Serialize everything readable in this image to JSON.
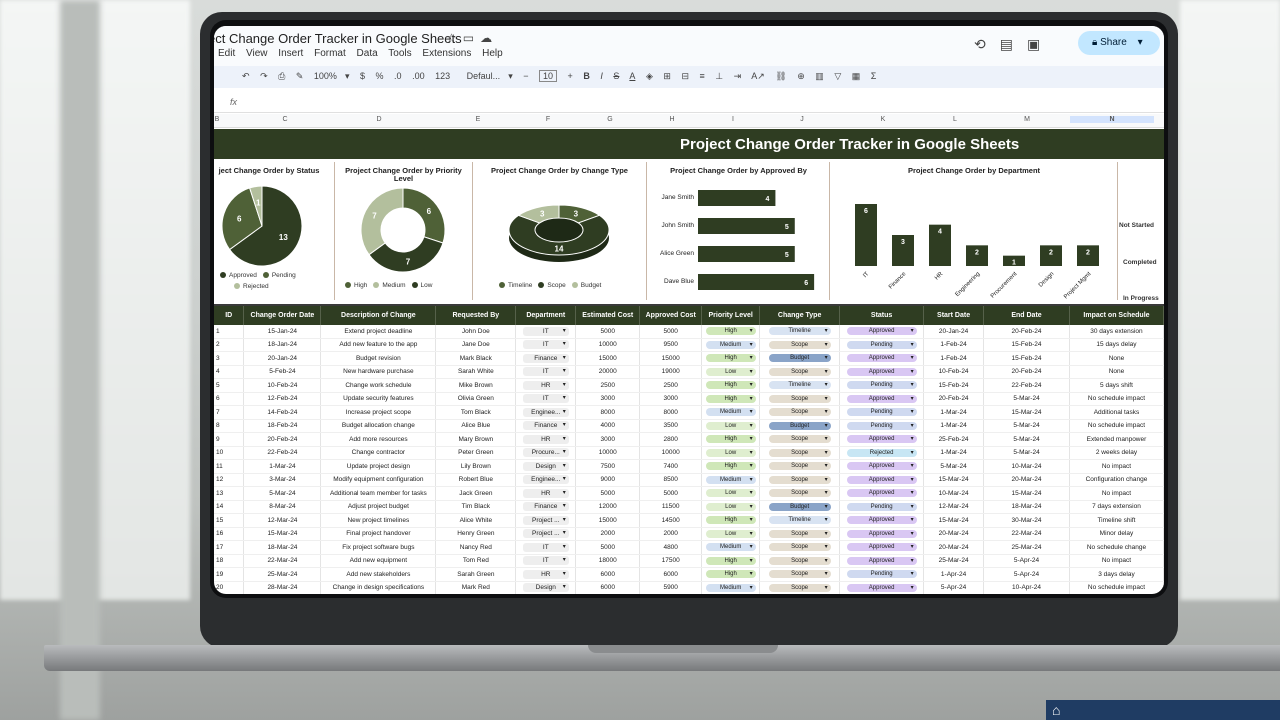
{
  "doc_title": "ect Change Order Tracker in Google Sheets",
  "menu": [
    "Edit",
    "View",
    "Insert",
    "Format",
    "Data",
    "Tools",
    "Extensions",
    "Help"
  ],
  "share_label": "Share",
  "toolbar": {
    "zoom": "100%",
    "font": "Defaul...",
    "font_size": "10",
    "format_num": "123",
    "currency": "$",
    "percent": "%"
  },
  "formula_icon": "fx",
  "columns": [
    "B",
    "C",
    "D",
    "E",
    "F",
    "G",
    "H",
    "I",
    "J",
    "K",
    "L",
    "M",
    "N"
  ],
  "banner": "Project Change Order Tracker in Google Sheets",
  "charts": {
    "status": {
      "title": "ject Change Order by Status",
      "legend": [
        "Approved",
        "Pending",
        "Rejected"
      ],
      "values": [
        13,
        6,
        1
      ]
    },
    "priority": {
      "title": "Project Change Order by Priority Level",
      "legend": [
        "High",
        "Medium",
        "Low"
      ],
      "values": [
        6,
        7,
        7
      ]
    },
    "type": {
      "title": "Project Change Order by Change Type",
      "legend": [
        "Timeline",
        "Scope",
        "Budget"
      ],
      "values": [
        3,
        14,
        3
      ]
    },
    "approved": {
      "title": "Project Change Order by Approved By",
      "names": [
        "Jane Smith",
        "John Smith",
        "Alice Green",
        "Dave Blue"
      ],
      "values": [
        4,
        5,
        5,
        6
      ]
    },
    "department": {
      "title": "Project Change Order by Department",
      "names": [
        "IT",
        "Finance",
        "HR",
        "Engineering",
        "Procurement",
        "Design",
        "Project Mgmt"
      ],
      "values": [
        6,
        3,
        4,
        2,
        1,
        2,
        2
      ]
    },
    "progress": {
      "labels": [
        "Not Started",
        "Completed",
        "In Progress"
      ]
    }
  },
  "colors": {
    "dark": "#2f3d22",
    "mid": "#4f6137",
    "light": "#b3bf9d",
    "approved": "#d9c7f3",
    "pending": "#cfd9f0",
    "rejected": "#c7e6f4",
    "high": "#cfe7b8",
    "medium": "#d3e0f1",
    "low": "#dfeecf",
    "timeline": "#d8e3f2",
    "scope": "#e4ddd0",
    "budget": "#8aa4c8"
  },
  "table_headers": [
    "ID",
    "Change Order Date",
    "Description of Change",
    "Requested By",
    "Department",
    "Estimated Cost",
    "Approved Cost",
    "Priority Level",
    "Change Type",
    "Status",
    "Start Date",
    "End Date",
    "Impact on Schedule"
  ],
  "rows": [
    [
      "1",
      "15-Jan-24",
      "Extend project deadline",
      "John Doe",
      "IT",
      "5000",
      "5000",
      "High",
      "Timeline",
      "Approved",
      "20-Jan-24",
      "20-Feb-24",
      "30 days extension"
    ],
    [
      "2",
      "18-Jan-24",
      "Add new feature to the app",
      "Jane Doe",
      "IT",
      "10000",
      "9500",
      "Medium",
      "Scope",
      "Pending",
      "1-Feb-24",
      "15-Feb-24",
      "15 days delay"
    ],
    [
      "3",
      "20-Jan-24",
      "Budget revision",
      "Mark Black",
      "Finance",
      "15000",
      "15000",
      "High",
      "Budget",
      "Approved",
      "1-Feb-24",
      "15-Feb-24",
      "None"
    ],
    [
      "4",
      "5-Feb-24",
      "New hardware purchase",
      "Sarah White",
      "IT",
      "20000",
      "19000",
      "Low",
      "Scope",
      "Approved",
      "10-Feb-24",
      "20-Feb-24",
      "None"
    ],
    [
      "5",
      "10-Feb-24",
      "Change work schedule",
      "Mike Brown",
      "HR",
      "2500",
      "2500",
      "High",
      "Timeline",
      "Pending",
      "15-Feb-24",
      "22-Feb-24",
      "5 days shift"
    ],
    [
      "6",
      "12-Feb-24",
      "Update security features",
      "Olivia Green",
      "IT",
      "3000",
      "3000",
      "High",
      "Scope",
      "Approved",
      "20-Feb-24",
      "5-Mar-24",
      "No schedule impact"
    ],
    [
      "7",
      "14-Feb-24",
      "Increase project scope",
      "Tom Black",
      "Enginee...",
      "8000",
      "8000",
      "Medium",
      "Scope",
      "Pending",
      "1-Mar-24",
      "15-Mar-24",
      "Additional tasks"
    ],
    [
      "8",
      "18-Feb-24",
      "Budget allocation change",
      "Alice Blue",
      "Finance",
      "4000",
      "3500",
      "Low",
      "Budget",
      "Pending",
      "1-Mar-24",
      "5-Mar-24",
      "No schedule impact"
    ],
    [
      "9",
      "20-Feb-24",
      "Add more resources",
      "Mary Brown",
      "HR",
      "3000",
      "2800",
      "High",
      "Scope",
      "Approved",
      "25-Feb-24",
      "5-Mar-24",
      "Extended manpower"
    ],
    [
      "10",
      "22-Feb-24",
      "Change contractor",
      "Peter Green",
      "Procure...",
      "10000",
      "10000",
      "Low",
      "Scope",
      "Rejected",
      "1-Mar-24",
      "5-Mar-24",
      "2 weeks delay"
    ],
    [
      "11",
      "1-Mar-24",
      "Update project design",
      "Lily Brown",
      "Design",
      "7500",
      "7400",
      "High",
      "Scope",
      "Approved",
      "5-Mar-24",
      "10-Mar-24",
      "No impact"
    ],
    [
      "12",
      "3-Mar-24",
      "Modify equipment configuration",
      "Robert Blue",
      "Enginee...",
      "9000",
      "8500",
      "Medium",
      "Scope",
      "Approved",
      "15-Mar-24",
      "20-Mar-24",
      "Configuration change"
    ],
    [
      "13",
      "5-Mar-24",
      "Additional team member for tasks",
      "Jack Green",
      "HR",
      "5000",
      "5000",
      "Low",
      "Scope",
      "Approved",
      "10-Mar-24",
      "15-Mar-24",
      "No impact"
    ],
    [
      "14",
      "8-Mar-24",
      "Adjust project budget",
      "Tim Black",
      "Finance",
      "12000",
      "11500",
      "Low",
      "Budget",
      "Pending",
      "12-Mar-24",
      "18-Mar-24",
      "7 days extension"
    ],
    [
      "15",
      "12-Mar-24",
      "New project timelines",
      "Alice White",
      "Project ...",
      "15000",
      "14500",
      "High",
      "Timeline",
      "Approved",
      "15-Mar-24",
      "30-Mar-24",
      "Timeline shift"
    ],
    [
      "16",
      "15-Mar-24",
      "Final project handover",
      "Henry Green",
      "Project ...",
      "2000",
      "2000",
      "Low",
      "Scope",
      "Approved",
      "20-Mar-24",
      "22-Mar-24",
      "Minor delay"
    ],
    [
      "17",
      "18-Mar-24",
      "Fix project software bugs",
      "Nancy Red",
      "IT",
      "5000",
      "4800",
      "Medium",
      "Scope",
      "Approved",
      "20-Mar-24",
      "25-Mar-24",
      "No schedule change"
    ],
    [
      "18",
      "22-Mar-24",
      "Add new equipment",
      "Tom Red",
      "IT",
      "18000",
      "17500",
      "High",
      "Scope",
      "Approved",
      "25-Mar-24",
      "5-Apr-24",
      "No impact"
    ],
    [
      "19",
      "25-Mar-24",
      "Add new stakeholders",
      "Sarah Green",
      "HR",
      "6000",
      "6000",
      "High",
      "Scope",
      "Pending",
      "1-Apr-24",
      "5-Apr-24",
      "3 days delay"
    ],
    [
      "20",
      "28-Mar-24",
      "Change in design specifications",
      "Mark Red",
      "Design",
      "6000",
      "5900",
      "Medium",
      "Scope",
      "Approved",
      "5-Apr-24",
      "10-Apr-24",
      "No schedule impact"
    ]
  ]
}
